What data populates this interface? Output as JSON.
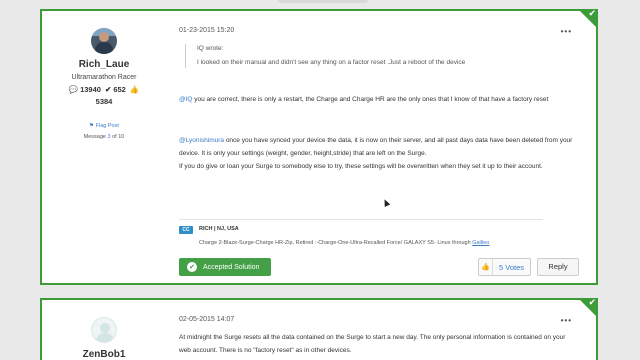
{
  "post1": {
    "author": {
      "name": "Rich_Laue",
      "rank": "Ultramarathon Racer",
      "posts": "13940",
      "solutions": "652",
      "kudos": "5384"
    },
    "flag_label": "Flag Post",
    "message_prefix": "Message",
    "message_num": "3",
    "message_of": "of 10",
    "date": "01-23-2015 15:20",
    "quote": {
      "header": "IQ wrote:",
      "text": "I looked on their manual and didn't see any thing on a factor reset .Just a reboot of the device"
    },
    "para1": {
      "mention": "@IQ",
      "text": " you are correct, there is only a restart, the Charge and Charge HR are the only ones that I know of that have a factory reset"
    },
    "para2": {
      "mention": "@Lyonishimura",
      "text": " once you have synced your device the data, it is now on their server, and all past days data have been deleted from your device. It is only your settings (weight, gender, height,stride) that are left on the Surge."
    },
    "para3": "If you do give or loan your Surge to somebody else to try, these settings will be overwritten when they set it up to their account.",
    "signature": {
      "badge": "CC",
      "name": "RICH | NJ, USA",
      "line": "Charge 2-Blaze-Surge-Charge HR-Zip, Retired :-Charge-One-Ultra-Recalled Force/ GALAXY S5- Linux through ",
      "link": "Galileo"
    },
    "accepted_label": "Accepted Solution",
    "kudos_label": "5 Votes",
    "reply_label": "Reply"
  },
  "post2": {
    "author": {
      "name": "ZenBob1"
    },
    "date": "02-05-2015 14:07",
    "text": "At midnight the Surge resets all the data contained on the Surge to start a new day. The only personal information is contained on your web account. There is no \"factory reset\" as in other devices."
  },
  "icons": {
    "check": "checkmark-icon",
    "thumb": "thumbs-up-icon",
    "menu": "ellipsis-icon"
  },
  "colors": {
    "accent_green": "#3e9b3a",
    "button_green": "#43a047",
    "link_blue": "#3a7bc8"
  }
}
